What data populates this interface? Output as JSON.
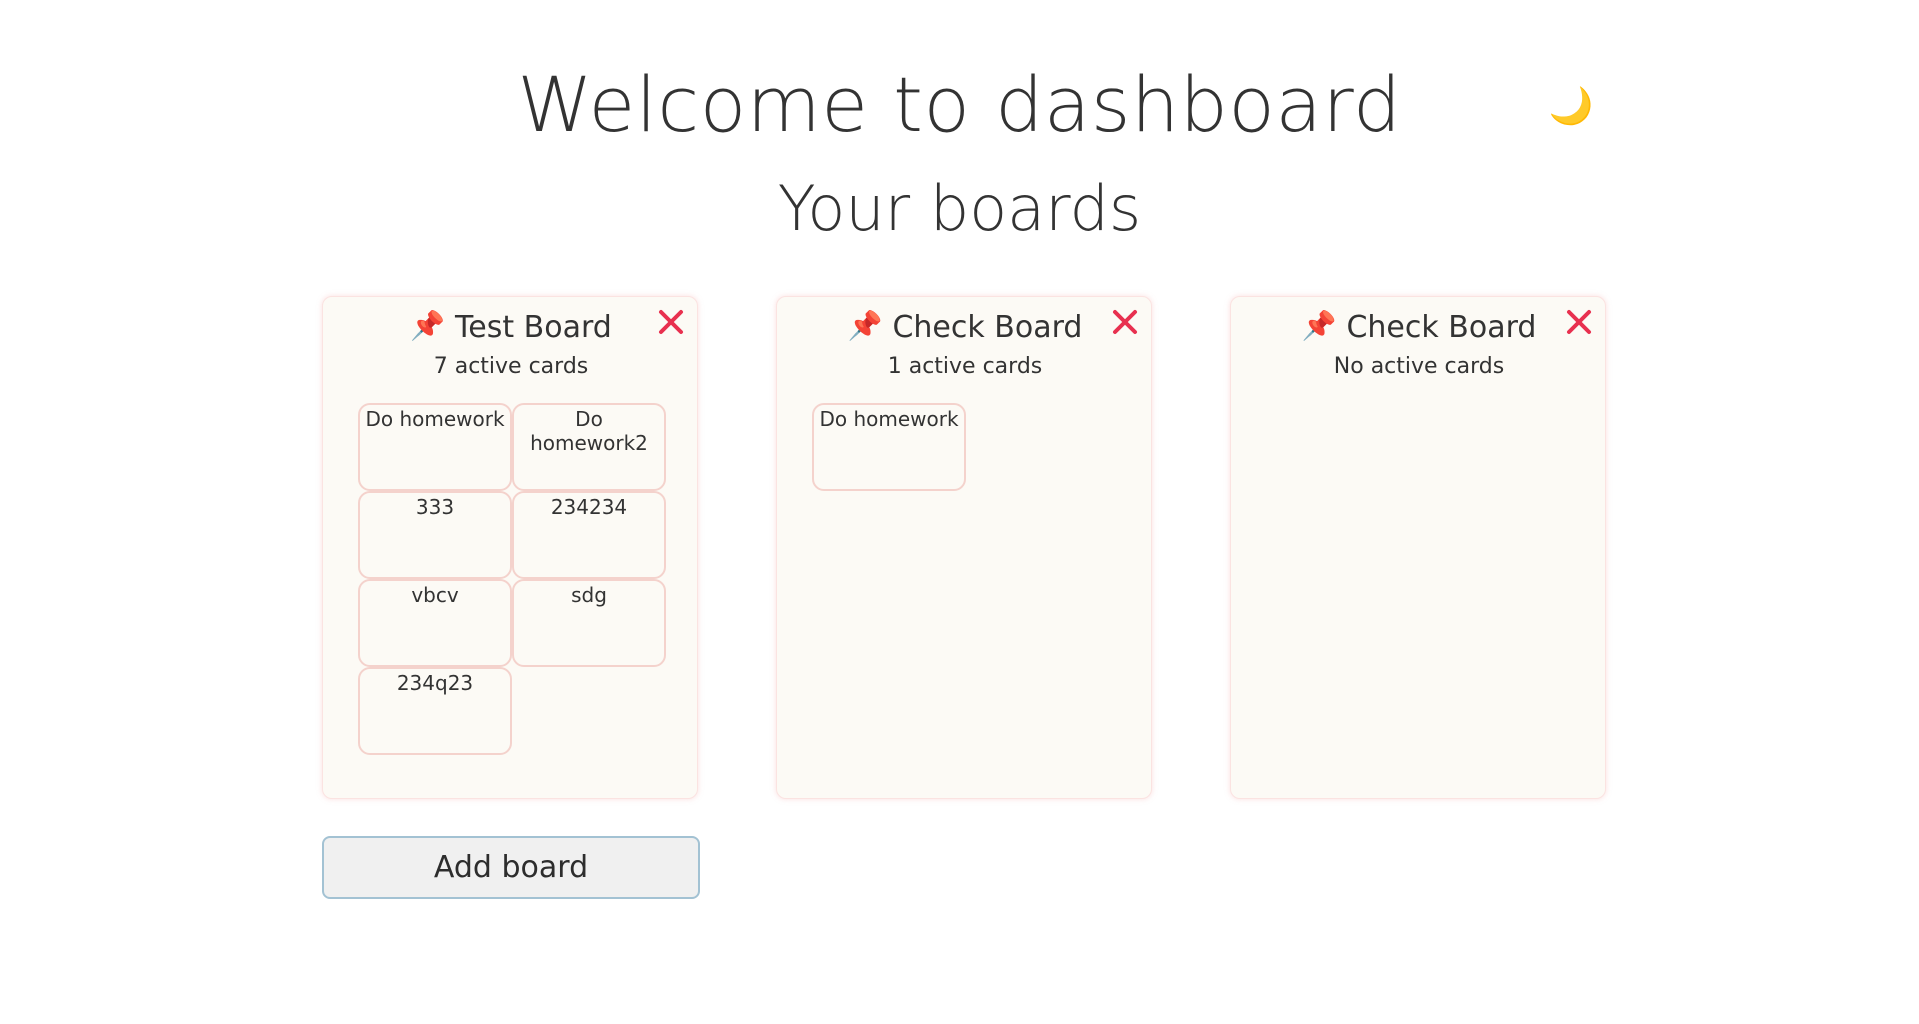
{
  "header": {
    "title": "Welcome to dashboard",
    "theme_toggle_icon": "🌙",
    "theme_toggle_icon_name": "moon-icon"
  },
  "section": {
    "subtitle": "Your boards"
  },
  "pin_icon": "📌",
  "colors": {
    "close": "#e8304f",
    "card_border": "#f4d2cc",
    "board_bg": "#fcfaf5",
    "button_border": "#a3c2d3"
  },
  "boards": [
    {
      "title": "Test Board",
      "count_text": "7 active cards",
      "cards": [
        "Do homework",
        "Do homework2",
        "333",
        "234234",
        "vbcv",
        "sdg",
        "234q23"
      ]
    },
    {
      "title": "Check Board",
      "count_text": "1 active cards",
      "cards": [
        "Do homework"
      ]
    },
    {
      "title": "Check Board",
      "count_text": "No active cards",
      "cards": []
    }
  ],
  "actions": {
    "add_board_label": "Add board"
  }
}
